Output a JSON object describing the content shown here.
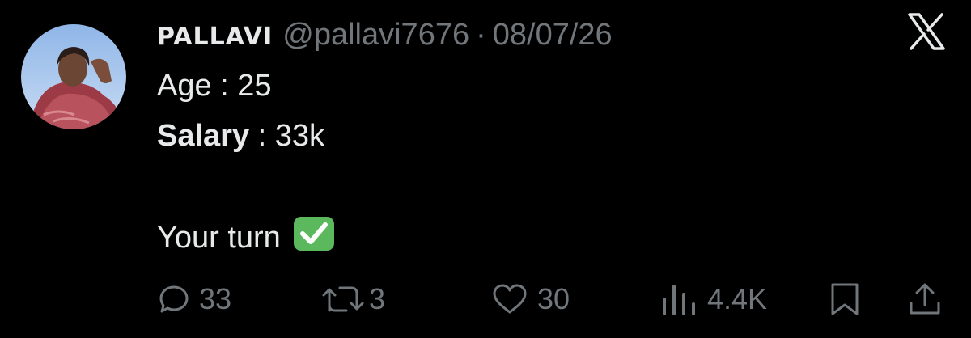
{
  "tweet": {
    "author_name": "PALLAVI",
    "handle": "@pallavi7676",
    "separator": "·",
    "date": "08/07/26",
    "line1": "Age : 25",
    "line2_label": "Salary",
    "line2_rest": " : 33k",
    "line3": "Your turn",
    "line3_icon": "check-mark-button-emoji"
  },
  "actions": {
    "reply_count": "33",
    "retweet_count": "3",
    "like_count": "30",
    "views_count": "4.4K"
  },
  "icons": {
    "close": "x-logo-icon",
    "reply": "reply-icon",
    "retweet": "retweet-icon",
    "like": "heart-icon",
    "views": "views-bar-chart-icon",
    "bookmark": "bookmark-icon",
    "share": "share-icon"
  },
  "colors": {
    "background": "#000000",
    "text_primary": "#e7e9ea",
    "text_secondary": "#71767b",
    "check_green": "#5cb85c"
  }
}
